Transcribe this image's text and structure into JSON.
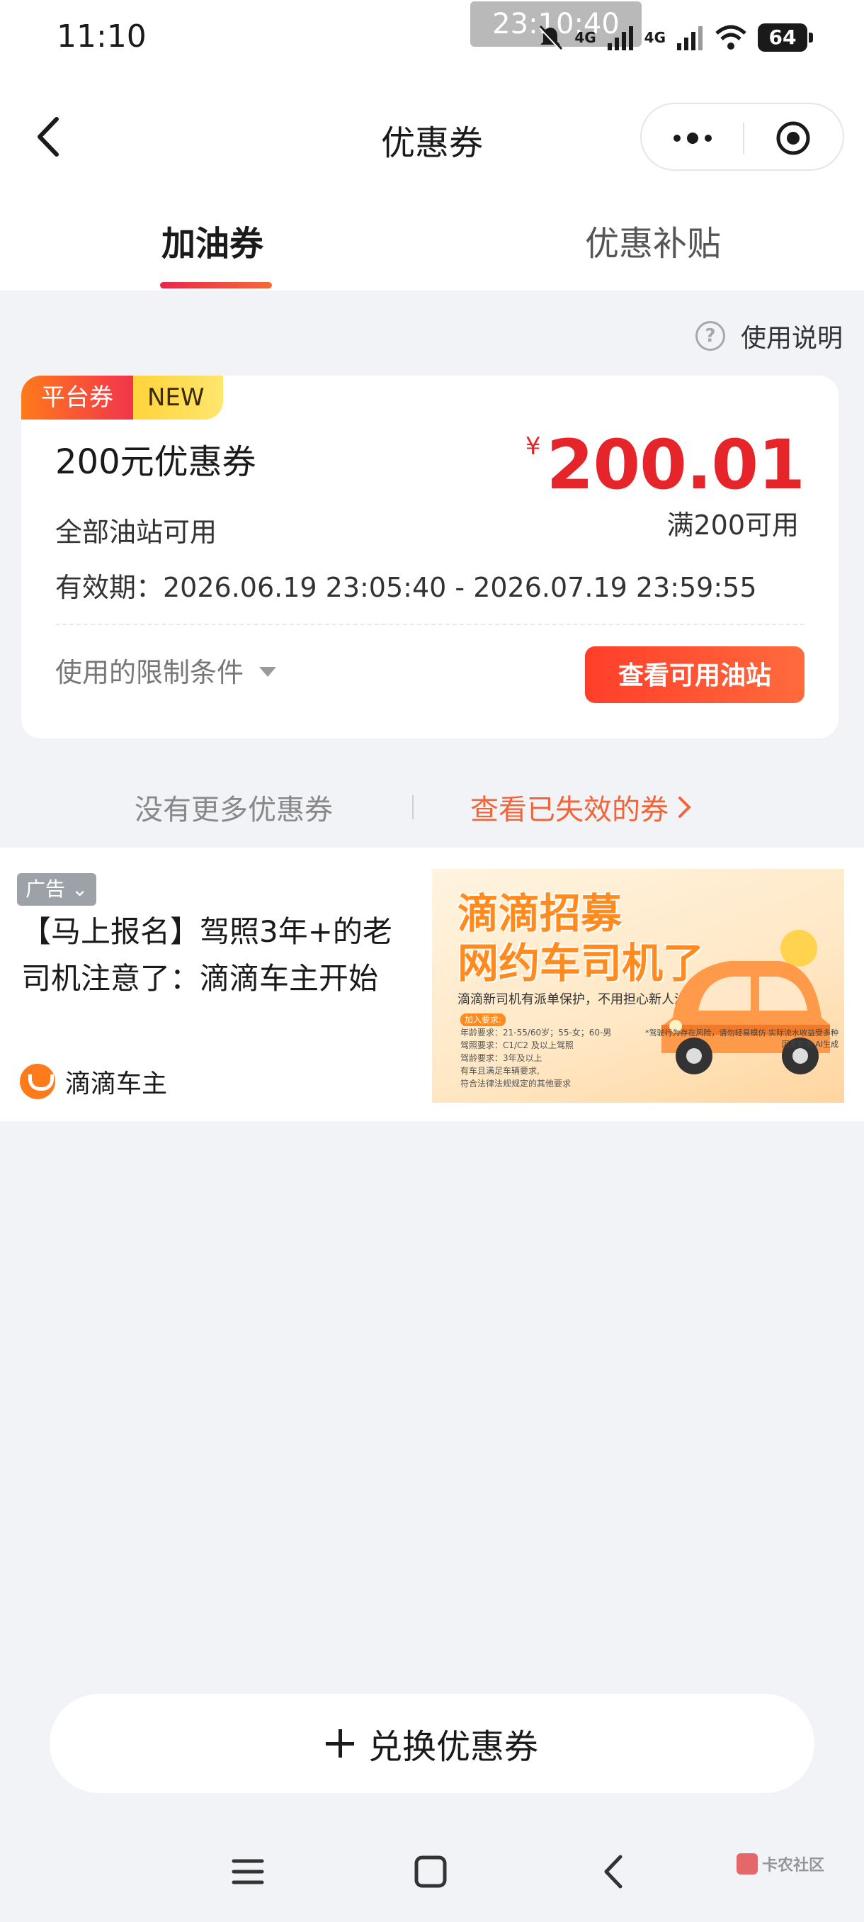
{
  "status_bar": {
    "time": "11:10",
    "overlay_time": "23:10:40",
    "network_1": "4G",
    "network_2": "4G",
    "battery": "64"
  },
  "nav": {
    "title": "优惠券"
  },
  "tabs": [
    {
      "label": "加油券",
      "active": true
    },
    {
      "label": "优惠补贴",
      "active": false
    }
  ],
  "usage": {
    "label": "使用说明"
  },
  "coupon": {
    "badge_platform": "平台券",
    "badge_new": "NEW",
    "title": "200元优惠券",
    "subtitle": "全部油站可用",
    "validity": "有效期：2026.06.19 23:05:40 - 2026.07.19 23:59:55",
    "currency": "¥",
    "amount": "200.01",
    "threshold": "满200可用",
    "limit_label": "使用的限制条件",
    "action_label": "查看可用油站",
    "accent_color": "#e5252a"
  },
  "list_footer": {
    "no_more": "没有更多优惠券",
    "expired_link": "查看已失效的券"
  },
  "ad": {
    "tag": "广告",
    "text": "【马上报名】驾照3年+的老司机注意了：滴滴车主开始",
    "brand": "滴滴车主",
    "image_title_1": "滴滴招募",
    "image_title_2": "网约车司机了",
    "image_line": "滴滴新司机有派单保护，不用担心新人没有单!",
    "req_tag": "加入要求:",
    "req_1": "年龄要求：21-55/60岁；55-女；60-男",
    "req_2": "驾照要求：C1/C2 及以上驾照",
    "req_3": "驾龄要求：3年及以上",
    "req_4": "有车且满足车辆要求,",
    "req_5": "符合法律法规规定的其他要求",
    "notice": "*驾驶行为存在风险，请勿轻易模仿 实际流水收益受多种因素影响 AI生成"
  },
  "redeem": {
    "label": "兑换优惠券"
  },
  "watermark": {
    "text": "卡农社区"
  }
}
